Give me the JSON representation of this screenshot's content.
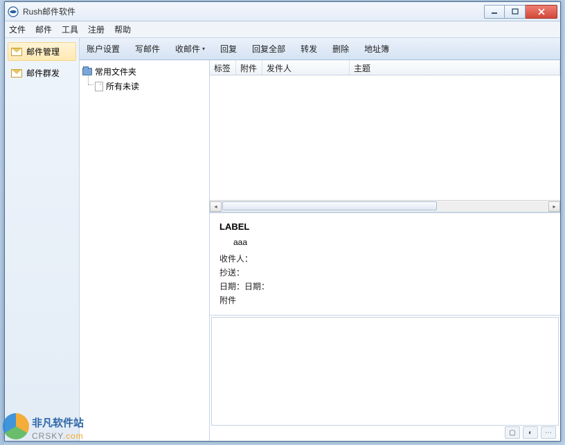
{
  "window": {
    "title": "Rush邮件软件"
  },
  "menubar": [
    "文件",
    "邮件",
    "工具",
    "注册",
    "帮助"
  ],
  "leftnav": [
    {
      "label": "邮件管理",
      "selected": true
    },
    {
      "label": "邮件群发",
      "selected": false
    }
  ],
  "toolbar": {
    "account_settings": "账户设置",
    "compose": "写邮件",
    "receive": "收邮件",
    "reply": "回复",
    "reply_all": "回复全部",
    "forward": "转发",
    "delete": "删除",
    "address_book": "地址簿"
  },
  "tree": {
    "root": "常用文件夹",
    "children": [
      "所有未读"
    ]
  },
  "list_columns": {
    "tag": "标签",
    "attachment": "附件",
    "sender": "发件人",
    "subject": "主题"
  },
  "preview": {
    "label": "LABEL",
    "sub": "aaa",
    "to_label": "收件人：",
    "cc_label": "抄送：",
    "date_label": "日期：日期：",
    "attach_label": "附件"
  },
  "watermark": {
    "line1": "非凡软件站",
    "line2a": "CRSKY",
    "line2b": ".com"
  }
}
